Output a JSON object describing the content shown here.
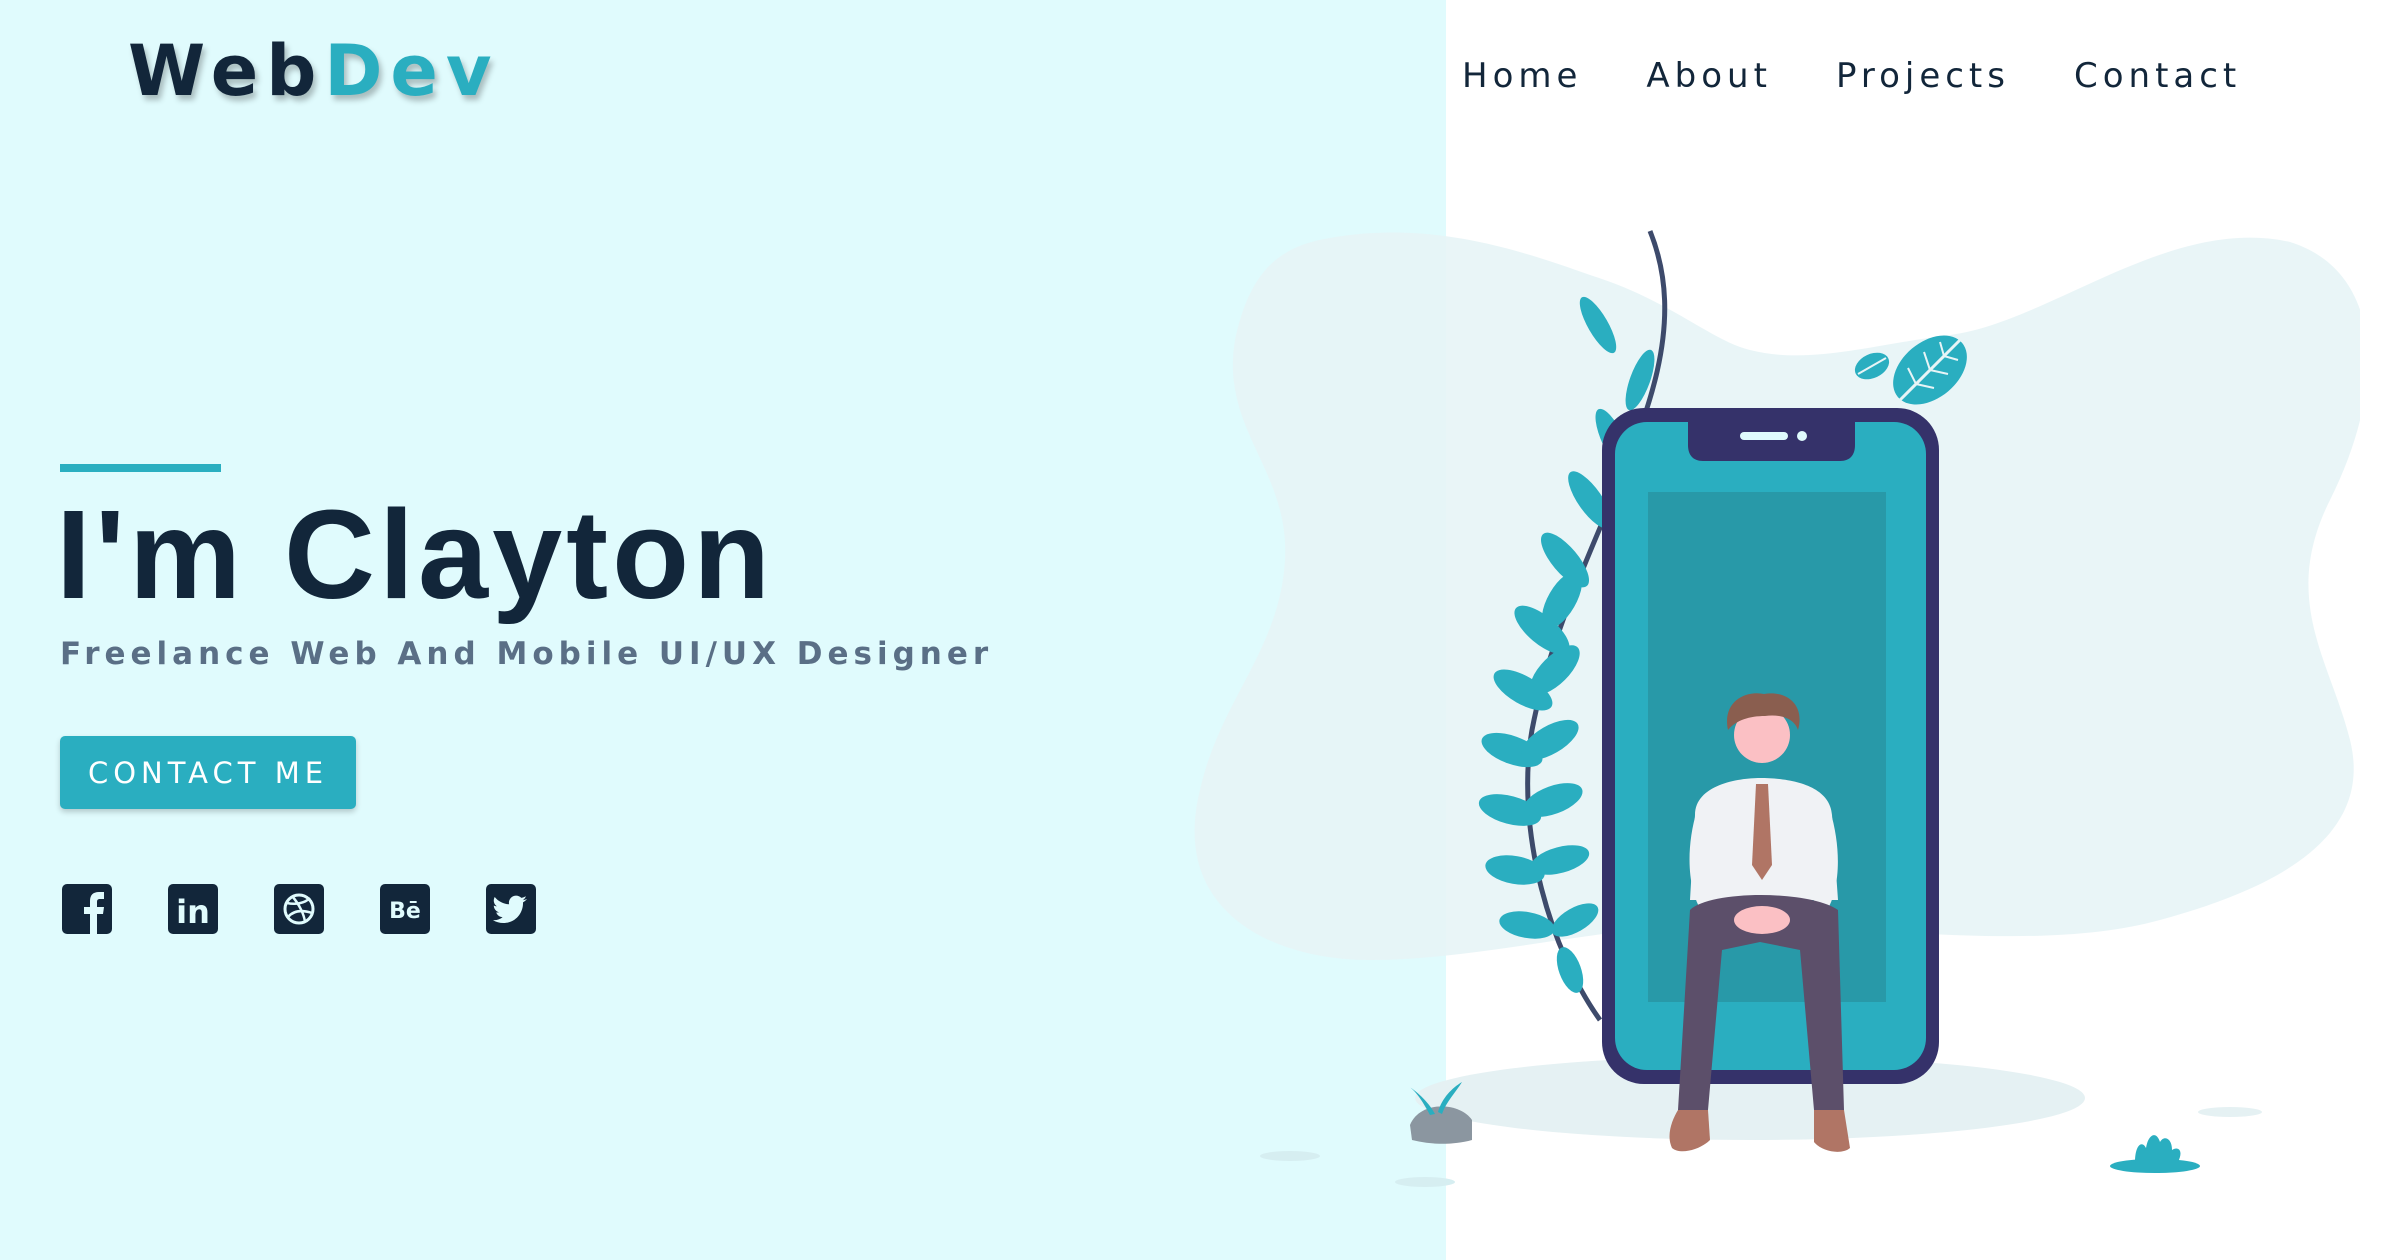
{
  "brand": {
    "logo_part1": "Web",
    "logo_part2": "Dev"
  },
  "nav": {
    "items": [
      "Home",
      "About",
      "Projects",
      "Contact"
    ]
  },
  "hero": {
    "title": "I'm Clayton",
    "subtitle": "Freelance Web And Mobile UI/UX Designer",
    "cta_label": "CONTACT ME"
  },
  "social": {
    "icons": [
      "facebook-icon",
      "linkedin-icon",
      "dribbble-icon",
      "behance-icon",
      "twitter-icon"
    ],
    "linkedin_text": "in",
    "behance_text": "Bē"
  },
  "colors": {
    "accent": "#2aaec0",
    "dark": "#12263a",
    "subtitle": "#5a6f86",
    "left_background": "#e0fbfd",
    "blob": "#e7f4f6",
    "phone_frame": "#35326a"
  },
  "illustration": {
    "subject": "person sitting in front of a large smartphone surrounded by leaves"
  }
}
